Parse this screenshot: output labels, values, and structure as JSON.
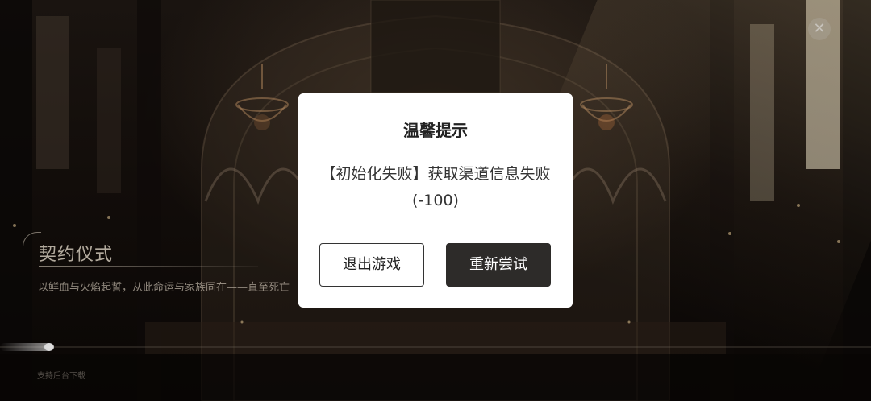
{
  "background": {
    "ritual_title": "契约仪式",
    "ritual_subtitle": "以鲜血与火焰起誓，从此命运与家族同在——直至死亡",
    "loading_hint": "支持后台下载",
    "close_icon": "close-icon",
    "loading_progress": 0.06
  },
  "dialog": {
    "title": "温馨提示",
    "message": "【初始化失败】获取渠道信息失败(-100)",
    "exit_button": "退出游戏",
    "retry_button": "重新尝试"
  },
  "colors": {
    "dialog_bg": "#ffffff",
    "primary_button": "#2d2b29",
    "text_dark": "#222222"
  }
}
